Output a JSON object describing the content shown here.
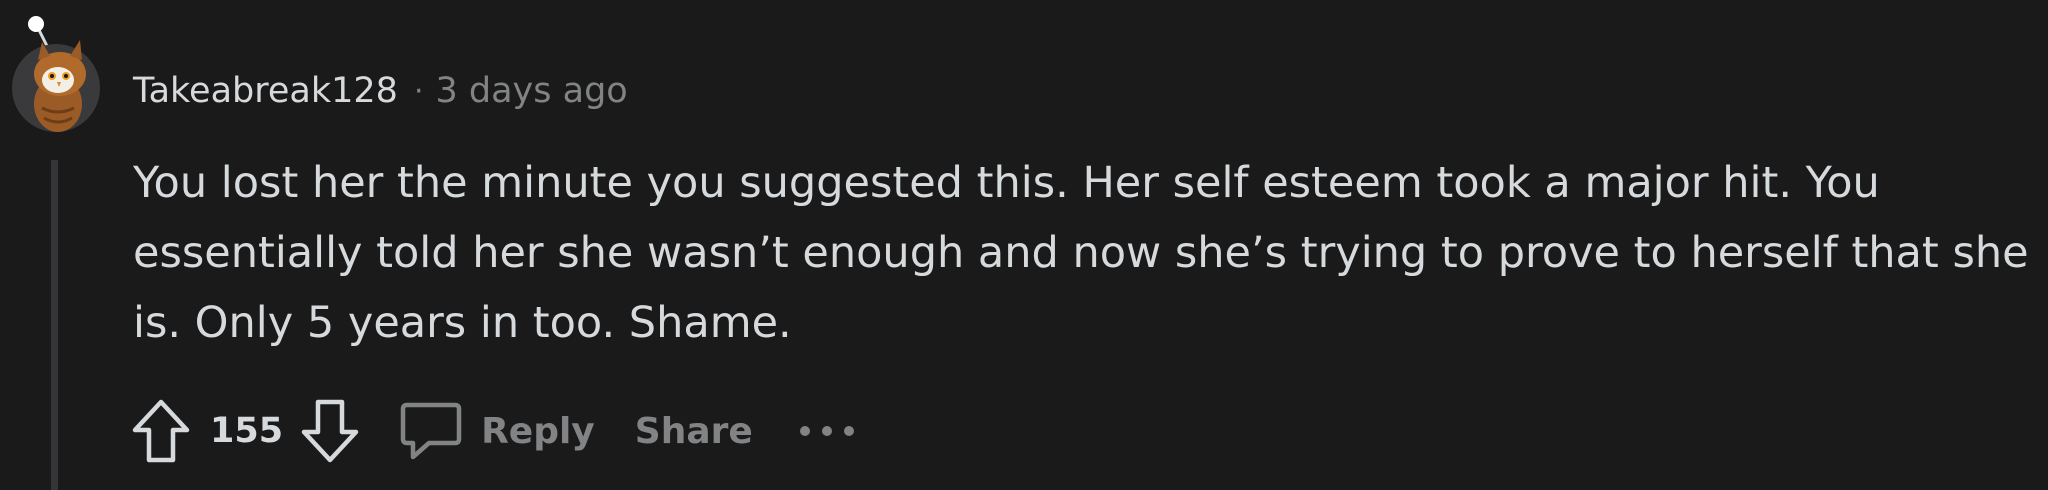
{
  "comment": {
    "author": "Takeabreak128",
    "separator": "·",
    "timestamp": "3 days ago",
    "body_lines": [
      "You lost her the minute you suggested this. Her self esteem took a major hit. You",
      "essentially told her she wasn’t enough and now she’s trying to prove to herself that she",
      "is. Only 5 years in too. Shame."
    ],
    "score": "155",
    "reply_label": "Reply",
    "share_label": "Share"
  },
  "icons": {
    "avatar": "owl-avatar-icon",
    "upvote": "upvote-arrow-icon",
    "downvote": "downvote-arrow-icon",
    "reply": "speech-bubble-icon",
    "more": "more-options-icon"
  },
  "colors": {
    "background": "#1a1a1b",
    "text_primary": "#d7dadc",
    "text_secondary": "#818384",
    "thread_line": "#343536"
  }
}
